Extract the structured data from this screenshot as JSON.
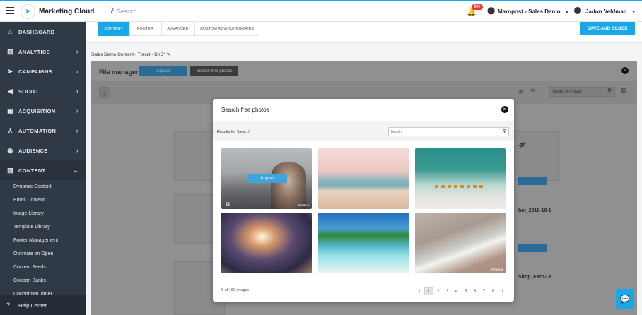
{
  "topbar": {
    "app_title": "Marketing Cloud",
    "search_placeholder": "Search",
    "notification_badge": "99+",
    "account_name": "Maropost - Sales Demo",
    "user_name": "Jadon Veldman"
  },
  "sidebar": {
    "items": [
      {
        "label": "DASHBOARD",
        "icon": "home-icon"
      },
      {
        "label": "ANALYTICS",
        "icon": "chart-icon"
      },
      {
        "label": "CAMPAIGNS",
        "icon": "paper-plane-icon"
      },
      {
        "label": "SOCIAL",
        "icon": "megaphone-icon"
      },
      {
        "label": "ACQUISITION",
        "icon": "toolbox-icon"
      },
      {
        "label": "AUTOMATION",
        "icon": "network-icon"
      },
      {
        "label": "AUDIENCE",
        "icon": "user-circle-icon"
      },
      {
        "label": "CONTENT",
        "icon": "content-icon"
      }
    ],
    "sub_items": [
      "Dynamic Content",
      "Email Content",
      "Image Library",
      "Template Library",
      "Footer Management",
      "Optimize on Open",
      "Content Feeds",
      "Coupon Banks",
      "Countdown Timer"
    ],
    "help": "Help Center"
  },
  "tabs": [
    "CONTENT",
    "FOOTER",
    "ADVANCED",
    "CUSTOM ROW CATEGORIES"
  ],
  "save_label": "SAVE AND CLOSE",
  "breadcrumb": "Sales Demo Content - Travel - DnD*",
  "file_manager": {
    "title": "File manager",
    "upload": "Upload",
    "search_photos": "Search free photos",
    "search_folder": "Search in folder",
    "card_labels": [
      ".gif",
      "hot_2018-10-1",
      "Shop_Earn-Le"
    ],
    "insert": "Insert"
  },
  "modal": {
    "title": "Search free photos",
    "results_label": "Results for \"beach\"",
    "search_value": "beach",
    "import_label": "Import",
    "credit": "PEXELS",
    "count_text": "6 of 160 images",
    "pages": [
      "1",
      "2",
      "3",
      "4",
      "5",
      "6",
      "7",
      "8"
    ],
    "current_page": "1"
  }
}
